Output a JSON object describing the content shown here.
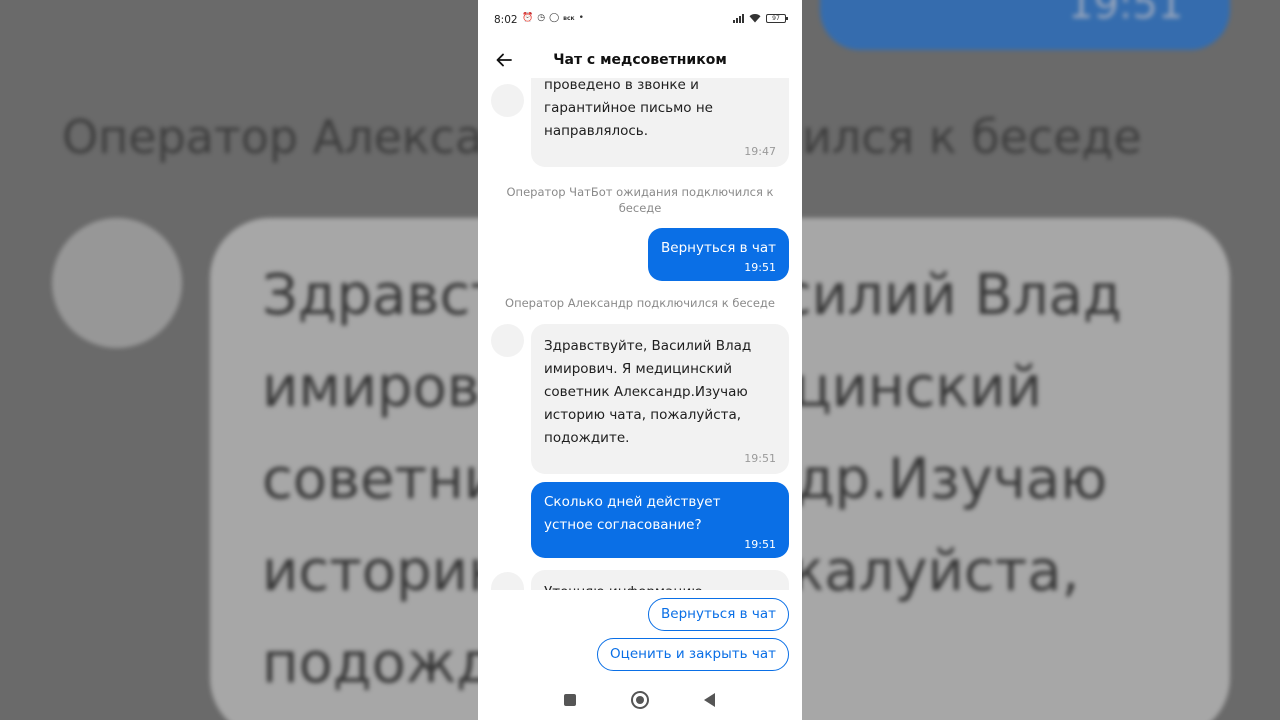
{
  "status_bar": {
    "time": "8:02",
    "vk": "вск",
    "dot": "•",
    "battery": "97"
  },
  "header": {
    "title": "Чат с медсоветником"
  },
  "background": {
    "time": "19:51",
    "system_text": "Оператор Александр подключился к беседе",
    "big_lines": [
      "Здравствуйте, Василий Влад",
      "имирович. Я медицинский",
      "советник Александр.Изучаю",
      "историю чата, пожалуйста,",
      "подождите."
    ]
  },
  "messages": [
    {
      "type": "in",
      "lines": [
        "проведено в звонке и",
        "гарантийное письмо не",
        "направлялось."
      ],
      "time": "19:47"
    },
    {
      "type": "system",
      "text": "Оператор ЧатБот ожидания подключился к беседе"
    },
    {
      "type": "out",
      "lines": [
        "Вернуться в чат"
      ],
      "time": "19:51"
    },
    {
      "type": "system",
      "text": "Оператор Александр подключился к беседе"
    },
    {
      "type": "in",
      "lines": [
        "Здравствуйте, Василий Влад",
        "имирович. Я медицинский",
        "советник Александр.Изучаю",
        "историю чата, пожалуйста,",
        "подождите."
      ],
      "time": "19:51"
    },
    {
      "type": "out",
      "lines": [
        "Сколько дней действует",
        "устное согласование?"
      ],
      "time": "19:51"
    },
    {
      "type": "in",
      "lines": [
        "Уточняю информацию"
      ],
      "time": ""
    }
  ],
  "quick_replies": {
    "return_label": "Вернуться в чат",
    "rate_close_label": "Оценить и закрыть чат"
  },
  "colors": {
    "accent": "#0a6fe6",
    "incoming_bubble": "#f2f2f2",
    "system_text": "#8a8a8a"
  }
}
